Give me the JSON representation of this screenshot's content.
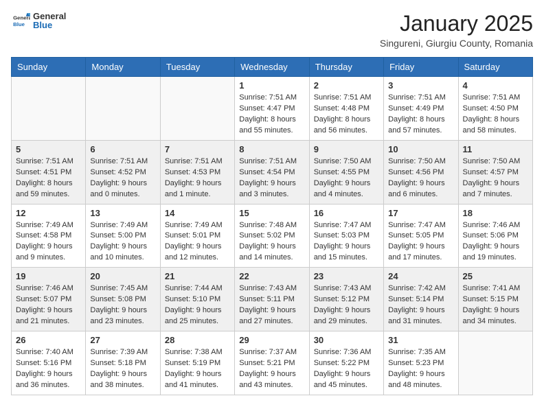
{
  "header": {
    "logo_general": "General",
    "logo_blue": "Blue",
    "month": "January 2025",
    "location": "Singureni, Giurgiu County, Romania"
  },
  "days_of_week": [
    "Sunday",
    "Monday",
    "Tuesday",
    "Wednesday",
    "Thursday",
    "Friday",
    "Saturday"
  ],
  "weeks": [
    [
      {
        "day": "",
        "sunrise": "",
        "sunset": "",
        "daylight": ""
      },
      {
        "day": "",
        "sunrise": "",
        "sunset": "",
        "daylight": ""
      },
      {
        "day": "",
        "sunrise": "",
        "sunset": "",
        "daylight": ""
      },
      {
        "day": "1",
        "sunrise": "Sunrise: 7:51 AM",
        "sunset": "Sunset: 4:47 PM",
        "daylight": "Daylight: 8 hours and 55 minutes."
      },
      {
        "day": "2",
        "sunrise": "Sunrise: 7:51 AM",
        "sunset": "Sunset: 4:48 PM",
        "daylight": "Daylight: 8 hours and 56 minutes."
      },
      {
        "day": "3",
        "sunrise": "Sunrise: 7:51 AM",
        "sunset": "Sunset: 4:49 PM",
        "daylight": "Daylight: 8 hours and 57 minutes."
      },
      {
        "day": "4",
        "sunrise": "Sunrise: 7:51 AM",
        "sunset": "Sunset: 4:50 PM",
        "daylight": "Daylight: 8 hours and 58 minutes."
      }
    ],
    [
      {
        "day": "5",
        "sunrise": "Sunrise: 7:51 AM",
        "sunset": "Sunset: 4:51 PM",
        "daylight": "Daylight: 8 hours and 59 minutes."
      },
      {
        "day": "6",
        "sunrise": "Sunrise: 7:51 AM",
        "sunset": "Sunset: 4:52 PM",
        "daylight": "Daylight: 9 hours and 0 minutes."
      },
      {
        "day": "7",
        "sunrise": "Sunrise: 7:51 AM",
        "sunset": "Sunset: 4:53 PM",
        "daylight": "Daylight: 9 hours and 1 minute."
      },
      {
        "day": "8",
        "sunrise": "Sunrise: 7:51 AM",
        "sunset": "Sunset: 4:54 PM",
        "daylight": "Daylight: 9 hours and 3 minutes."
      },
      {
        "day": "9",
        "sunrise": "Sunrise: 7:50 AM",
        "sunset": "Sunset: 4:55 PM",
        "daylight": "Daylight: 9 hours and 4 minutes."
      },
      {
        "day": "10",
        "sunrise": "Sunrise: 7:50 AM",
        "sunset": "Sunset: 4:56 PM",
        "daylight": "Daylight: 9 hours and 6 minutes."
      },
      {
        "day": "11",
        "sunrise": "Sunrise: 7:50 AM",
        "sunset": "Sunset: 4:57 PM",
        "daylight": "Daylight: 9 hours and 7 minutes."
      }
    ],
    [
      {
        "day": "12",
        "sunrise": "Sunrise: 7:49 AM",
        "sunset": "Sunset: 4:58 PM",
        "daylight": "Daylight: 9 hours and 9 minutes."
      },
      {
        "day": "13",
        "sunrise": "Sunrise: 7:49 AM",
        "sunset": "Sunset: 5:00 PM",
        "daylight": "Daylight: 9 hours and 10 minutes."
      },
      {
        "day": "14",
        "sunrise": "Sunrise: 7:49 AM",
        "sunset": "Sunset: 5:01 PM",
        "daylight": "Daylight: 9 hours and 12 minutes."
      },
      {
        "day": "15",
        "sunrise": "Sunrise: 7:48 AM",
        "sunset": "Sunset: 5:02 PM",
        "daylight": "Daylight: 9 hours and 14 minutes."
      },
      {
        "day": "16",
        "sunrise": "Sunrise: 7:47 AM",
        "sunset": "Sunset: 5:03 PM",
        "daylight": "Daylight: 9 hours and 15 minutes."
      },
      {
        "day": "17",
        "sunrise": "Sunrise: 7:47 AM",
        "sunset": "Sunset: 5:05 PM",
        "daylight": "Daylight: 9 hours and 17 minutes."
      },
      {
        "day": "18",
        "sunrise": "Sunrise: 7:46 AM",
        "sunset": "Sunset: 5:06 PM",
        "daylight": "Daylight: 9 hours and 19 minutes."
      }
    ],
    [
      {
        "day": "19",
        "sunrise": "Sunrise: 7:46 AM",
        "sunset": "Sunset: 5:07 PM",
        "daylight": "Daylight: 9 hours and 21 minutes."
      },
      {
        "day": "20",
        "sunrise": "Sunrise: 7:45 AM",
        "sunset": "Sunset: 5:08 PM",
        "daylight": "Daylight: 9 hours and 23 minutes."
      },
      {
        "day": "21",
        "sunrise": "Sunrise: 7:44 AM",
        "sunset": "Sunset: 5:10 PM",
        "daylight": "Daylight: 9 hours and 25 minutes."
      },
      {
        "day": "22",
        "sunrise": "Sunrise: 7:43 AM",
        "sunset": "Sunset: 5:11 PM",
        "daylight": "Daylight: 9 hours and 27 minutes."
      },
      {
        "day": "23",
        "sunrise": "Sunrise: 7:43 AM",
        "sunset": "Sunset: 5:12 PM",
        "daylight": "Daylight: 9 hours and 29 minutes."
      },
      {
        "day": "24",
        "sunrise": "Sunrise: 7:42 AM",
        "sunset": "Sunset: 5:14 PM",
        "daylight": "Daylight: 9 hours and 31 minutes."
      },
      {
        "day": "25",
        "sunrise": "Sunrise: 7:41 AM",
        "sunset": "Sunset: 5:15 PM",
        "daylight": "Daylight: 9 hours and 34 minutes."
      }
    ],
    [
      {
        "day": "26",
        "sunrise": "Sunrise: 7:40 AM",
        "sunset": "Sunset: 5:16 PM",
        "daylight": "Daylight: 9 hours and 36 minutes."
      },
      {
        "day": "27",
        "sunrise": "Sunrise: 7:39 AM",
        "sunset": "Sunset: 5:18 PM",
        "daylight": "Daylight: 9 hours and 38 minutes."
      },
      {
        "day": "28",
        "sunrise": "Sunrise: 7:38 AM",
        "sunset": "Sunset: 5:19 PM",
        "daylight": "Daylight: 9 hours and 41 minutes."
      },
      {
        "day": "29",
        "sunrise": "Sunrise: 7:37 AM",
        "sunset": "Sunset: 5:21 PM",
        "daylight": "Daylight: 9 hours and 43 minutes."
      },
      {
        "day": "30",
        "sunrise": "Sunrise: 7:36 AM",
        "sunset": "Sunset: 5:22 PM",
        "daylight": "Daylight: 9 hours and 45 minutes."
      },
      {
        "day": "31",
        "sunrise": "Sunrise: 7:35 AM",
        "sunset": "Sunset: 5:23 PM",
        "daylight": "Daylight: 9 hours and 48 minutes."
      },
      {
        "day": "",
        "sunrise": "",
        "sunset": "",
        "daylight": ""
      }
    ]
  ]
}
